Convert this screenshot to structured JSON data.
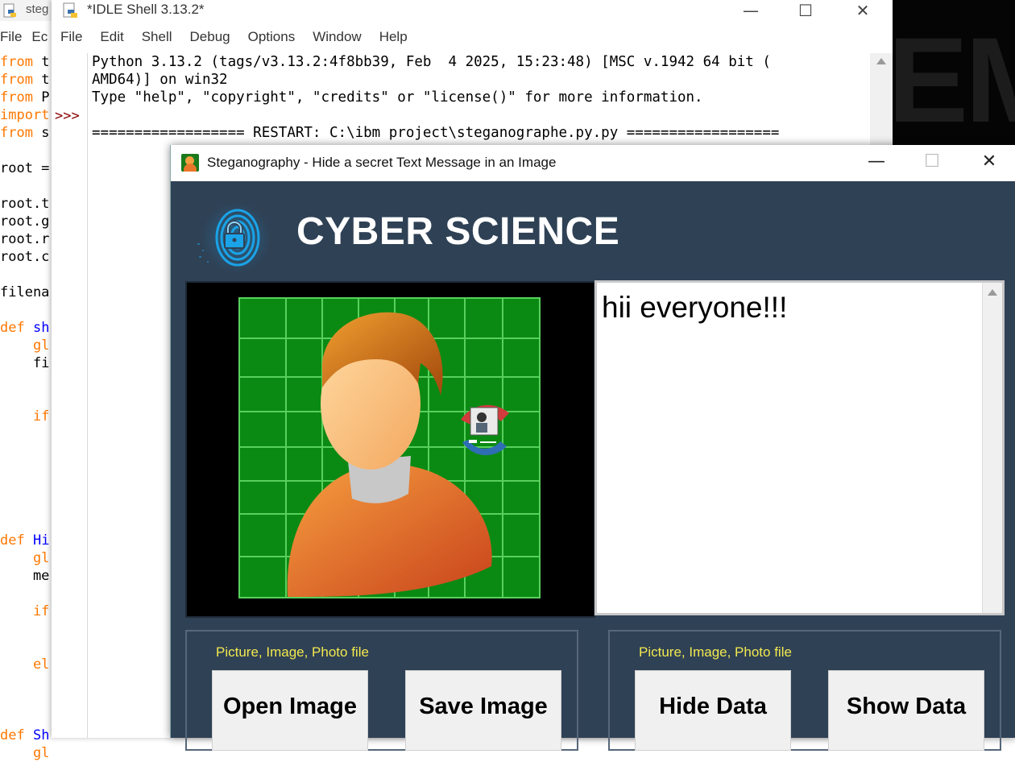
{
  "editor": {
    "title": "steg",
    "menu": [
      "File",
      "Ec"
    ],
    "code_lines": [
      [
        {
          "t": "from",
          "c": "kw"
        },
        {
          "t": " t",
          "c": "tx"
        }
      ],
      [
        {
          "t": "from",
          "c": "kw"
        },
        {
          "t": " t",
          "c": "tx"
        }
      ],
      [
        {
          "t": "from",
          "c": "kw"
        },
        {
          "t": " P",
          "c": "tx"
        }
      ],
      [
        {
          "t": "import",
          "c": "kw"
        }
      ],
      [
        {
          "t": "from",
          "c": "kw"
        },
        {
          "t": " s",
          "c": "tx"
        }
      ],
      [],
      [
        {
          "t": "root =",
          "c": "tx"
        }
      ],
      [],
      [
        {
          "t": "root.t",
          "c": "tx"
        }
      ],
      [
        {
          "t": "root.g",
          "c": "tx"
        }
      ],
      [
        {
          "t": "root.r",
          "c": "tx"
        }
      ],
      [
        {
          "t": "root.c",
          "c": "tx"
        }
      ],
      [],
      [
        {
          "t": "filena",
          "c": "tx"
        }
      ],
      [],
      [
        {
          "t": "def",
          "c": "kw"
        },
        {
          "t": " sh",
          "c": "fn"
        }
      ],
      [
        {
          "t": "    gl",
          "c": "kw"
        }
      ],
      [
        {
          "t": "    fi",
          "c": "tx"
        }
      ],
      [],
      [],
      [
        {
          "t": "    if",
          "c": "kw"
        }
      ],
      [],
      [],
      [],
      [],
      [],
      [],
      [
        {
          "t": "def",
          "c": "kw"
        },
        {
          "t": " Hi",
          "c": "fn"
        }
      ],
      [
        {
          "t": "    gl",
          "c": "kw"
        }
      ],
      [
        {
          "t": "    me",
          "c": "tx"
        }
      ],
      [],
      [
        {
          "t": "    if",
          "c": "kw"
        }
      ],
      [],
      [],
      [
        {
          "t": "    el",
          "c": "kw"
        }
      ],
      [],
      [],
      [],
      [
        {
          "t": "def",
          "c": "kw"
        },
        {
          "t": " Sh",
          "c": "fn"
        }
      ],
      [
        {
          "t": "    gl",
          "c": "kw"
        }
      ]
    ]
  },
  "shell": {
    "title": "*IDLE Shell 3.13.2*",
    "menu": [
      "File",
      "Edit",
      "Shell",
      "Debug",
      "Options",
      "Window",
      "Help"
    ],
    "prompt": ">>>",
    "output": "Python 3.13.2 (tags/v3.13.2:4f8bb39, Feb  4 2025, 15:23:48) [MSC v.1942 64 bit (\nAMD64)] on win32\nType \"help\", \"copyright\", \"credits\" or \"license()\" for more information.\n\n================== RESTART: C:\\ibm project\\steganographe.py.py =================="
  },
  "background_text": "EM",
  "steg": {
    "title": "Steganography - Hide a secret Text Message in an Image",
    "brand": "CYBER SCIENCE",
    "message": "hii everyone!!!",
    "left_panel": {
      "caption": "Picture, Image, Photo file",
      "btn1": "Open Image",
      "btn2": "Save Image"
    },
    "right_panel": {
      "caption": "Picture, Image, Photo file",
      "btn1": "Hide Data",
      "btn2": "Show Data"
    }
  },
  "window_controls": {
    "minimize": "—",
    "maximize": "☐",
    "close": "✕"
  },
  "colors": {
    "window_bg": "#2f4155",
    "caption": "#f2e94e",
    "keyword": "#ff7700",
    "def_name": "#0000ff",
    "prompt": "#8b0000"
  }
}
